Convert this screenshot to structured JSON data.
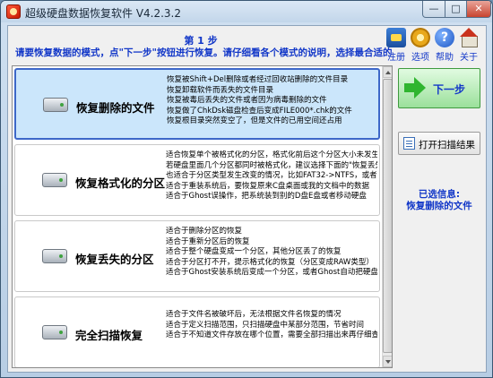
{
  "window": {
    "title": "超级硬盘数据恢复软件 V4.2.3.2",
    "controls": {
      "minimize": "—",
      "maximize": "□",
      "close": "✕"
    }
  },
  "header": {
    "step": "第 1 步",
    "instruction": "请要恢复数据的模式，点\"下一步\"按钮进行恢复。请仔细看各个模式的说明，选择最合适的模式。"
  },
  "toolbar": [
    {
      "label": "注册",
      "icon": "register-icon"
    },
    {
      "label": "选项",
      "icon": "options-icon"
    },
    {
      "label": "帮助",
      "icon": "help-icon"
    },
    {
      "label": "关于",
      "icon": "about-icon"
    }
  ],
  "modes": [
    {
      "label": "恢复删除的文件",
      "selected": true,
      "icon": "hard-disk-icon",
      "lines": [
        "恢复被Shift+Del删除或者经过回收站删除的文件目录",
        "恢复卸载软件而丢失的文件目录",
        "恢复被毒后丢失的文件或者因为病毒删除的文件",
        "恢复做了ChkDsk磁盘检查后变成FILE000*.chk的文件",
        "恢复根目录突然变空了，但是文件的已用空间还占用"
      ]
    },
    {
      "label": "恢复格式化的分区",
      "selected": false,
      "icon": "hard-disk-icon",
      "lines": [
        "适合恢复单个被格式化的分区，格式化前后这个分区大小未发生",
        "若硬盘里面几个分区都同时被格式化，建议选择下面的\"恢复丢失的",
        "也适合于分区类型发生改变的情况，比如FAT32->NTFS，或者NT",
        "适合于重装系统后，要恢复原来C盘桌面或我的文档中的数据",
        "适合于Ghost误操作，把系统装到别的D盘E盘或者移动硬盘"
      ]
    },
    {
      "label": "恢复丢失的分区",
      "selected": false,
      "icon": "hard-disk-icon",
      "lines": [
        "适合于删除分区的恢复",
        "适合于重新分区后的恢复",
        "适合于整个硬盘变成一个分区，其他分区丢了的恢复",
        "适合于分区打不开，提示格式化的恢复（分区变成RAW类型）",
        "适合于Ghost安装系统后变成一个分区，或者Ghost自动把硬盘分"
      ]
    },
    {
      "label": "完全扫描恢复",
      "selected": false,
      "icon": "hard-disk-icon",
      "lines": [
        "适合于文件名被破坏后，无法根据文件名恢复的情况",
        "适合于定义扫描范围，只扫描硬盘中某部分范围，节省时间",
        "适合于不知道文件存放在哪个位置，需要全部扫描出来再仔细查"
      ]
    }
  ],
  "sidebar": {
    "next_label": "下一步",
    "open_scan_label": "打开扫描结果",
    "selected_info_title": "已选信息:",
    "selected_info_value": "恢复删除的文件"
  }
}
